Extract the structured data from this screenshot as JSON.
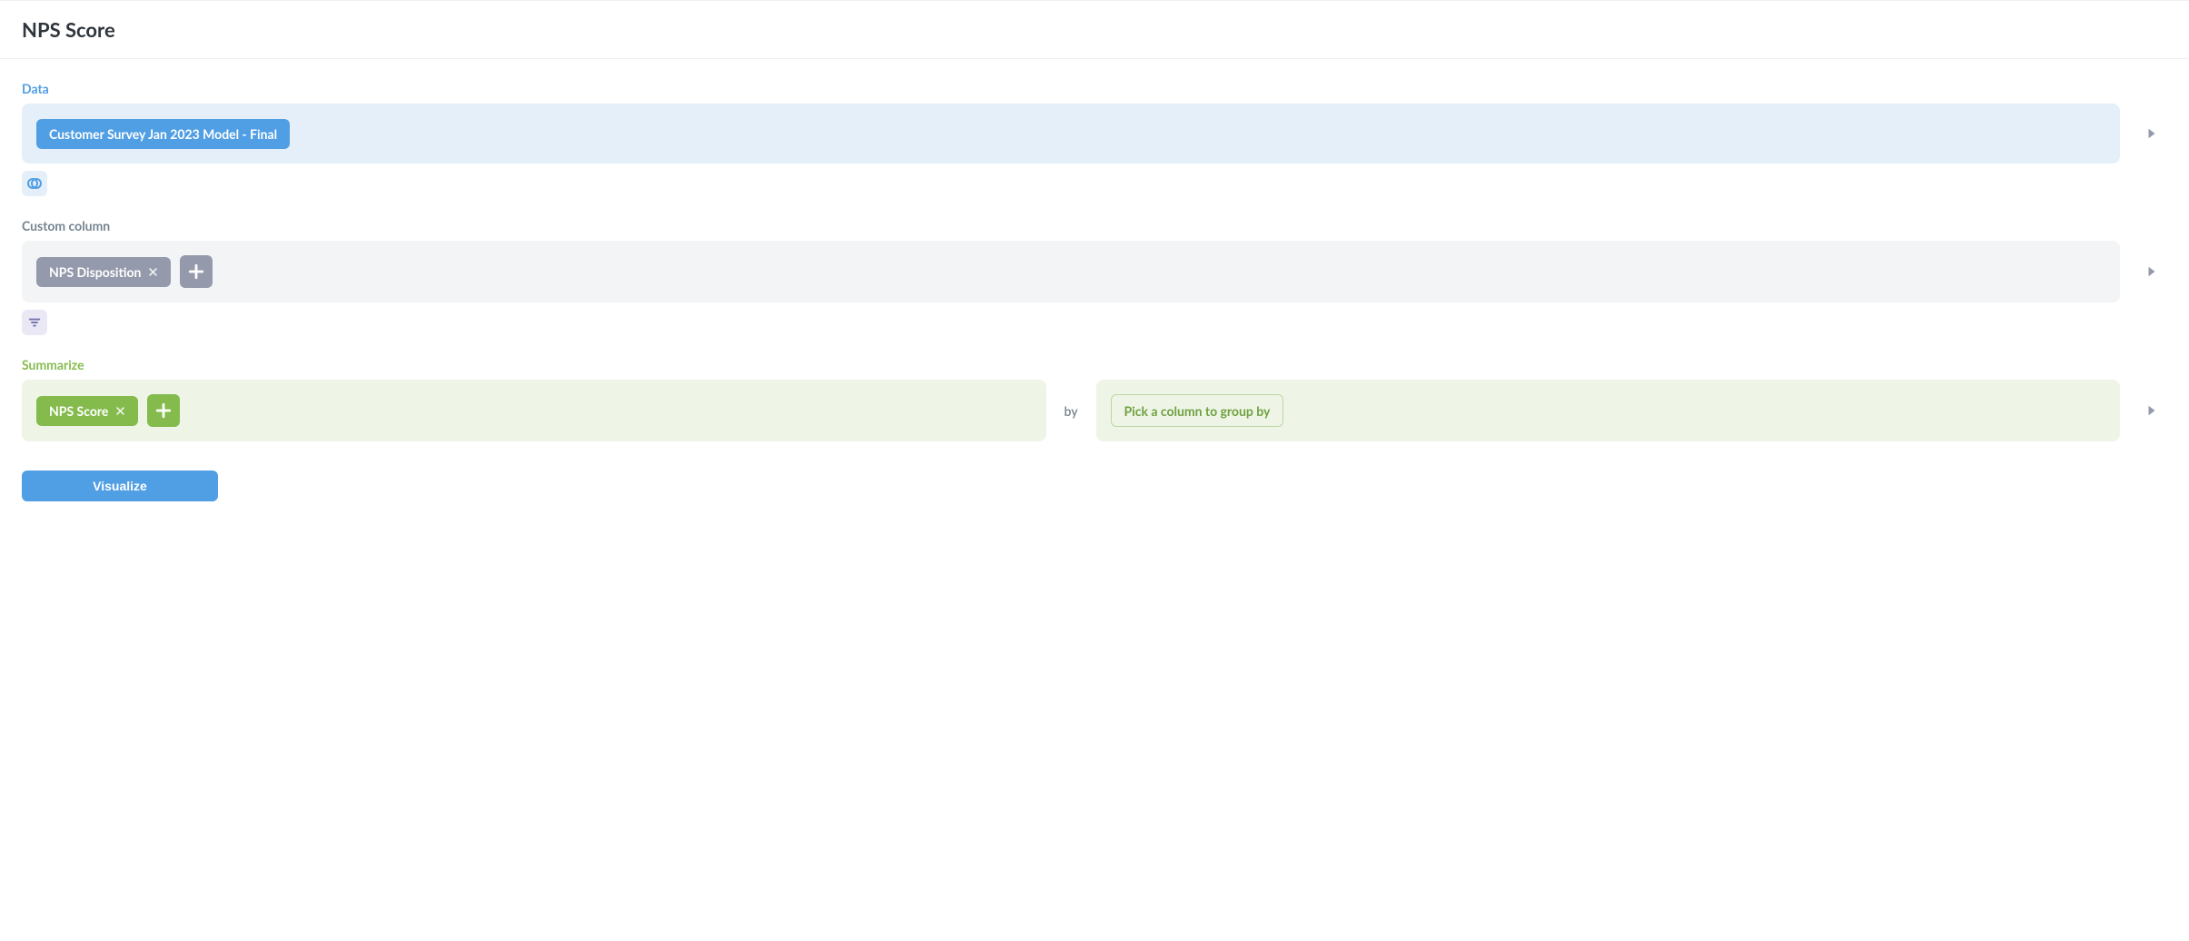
{
  "header": {
    "title": "NPS Score"
  },
  "data_section": {
    "label": "Data",
    "source_pill": "Customer Survey Jan 2023 Model - Final"
  },
  "custom_column_section": {
    "label": "Custom column",
    "columns": [
      "NPS Disposition"
    ]
  },
  "summarize_section": {
    "label": "Summarize",
    "metrics": [
      "NPS Score"
    ],
    "by_label": "by",
    "groupby_placeholder": "Pick a column to group by"
  },
  "actions": {
    "visualize": "Visualize"
  }
}
